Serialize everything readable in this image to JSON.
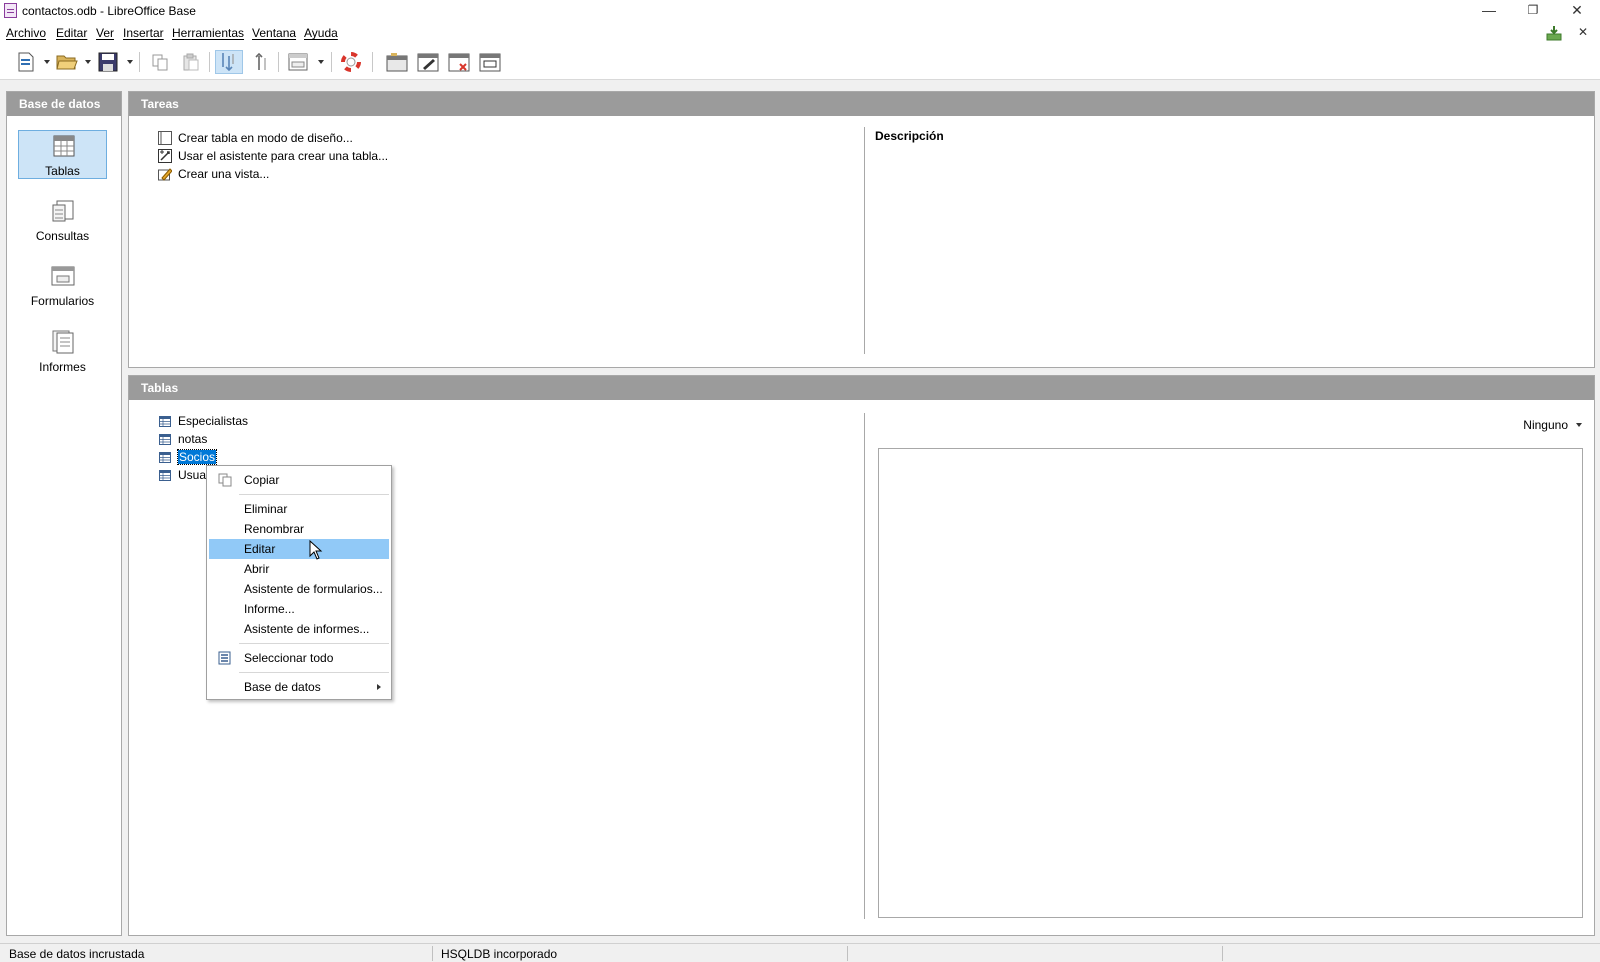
{
  "window": {
    "title": "contactos.odb - LibreOffice Base",
    "minimize": "—",
    "restore": "❐",
    "close": "✕",
    "doc_close": "✕"
  },
  "menubar": {
    "items": [
      "Archivo",
      "Editar",
      "Ver",
      "Insertar",
      "Herramientas",
      "Ventana",
      "Ayuda"
    ]
  },
  "sidebar": {
    "header": "Base de datos",
    "items": [
      {
        "label": "Tablas",
        "icon": "tables-icon",
        "selected": true
      },
      {
        "label": "Consultas",
        "icon": "queries-icon"
      },
      {
        "label": "Formularios",
        "icon": "forms-icon"
      },
      {
        "label": "Informes",
        "icon": "reports-icon"
      }
    ]
  },
  "tasks": {
    "header": "Tareas",
    "items": [
      {
        "label": "Crear tabla en modo de diseño...",
        "icon": "design-table-icon"
      },
      {
        "label": "Usar el asistente para crear una tabla...",
        "icon": "table-wizard-icon"
      },
      {
        "label": "Crear una vista...",
        "icon": "create-view-icon"
      }
    ],
    "description_title": "Descripción"
  },
  "tables": {
    "header": "Tablas",
    "items": [
      "Especialistas",
      "notas",
      "Socios",
      "Usuar"
    ],
    "selected": "Socios",
    "preview_mode": "Ninguno"
  },
  "context_menu": {
    "items": [
      {
        "label": "Copiar",
        "icon": "copy-icon"
      },
      {
        "label": "Eliminar"
      },
      {
        "label": "Renombrar"
      },
      {
        "label": "Editar",
        "highlighted": true
      },
      {
        "label": "Abrir"
      },
      {
        "label": "Asistente de formularios..."
      },
      {
        "label": "Informe..."
      },
      {
        "label": "Asistente de informes..."
      },
      {
        "label": "Seleccionar todo",
        "icon": "select-all-icon"
      },
      {
        "label": "Base de datos",
        "submenu": true
      }
    ]
  },
  "statusbar": {
    "left": "Base de datos incrustada",
    "middle": "HSQLDB incorporado"
  },
  "colors": {
    "panel_header": "#9b9b9b",
    "selection": "#cde4f7",
    "menu_highlight": "#91c9f7",
    "selected_text_bg": "#0078d7"
  }
}
